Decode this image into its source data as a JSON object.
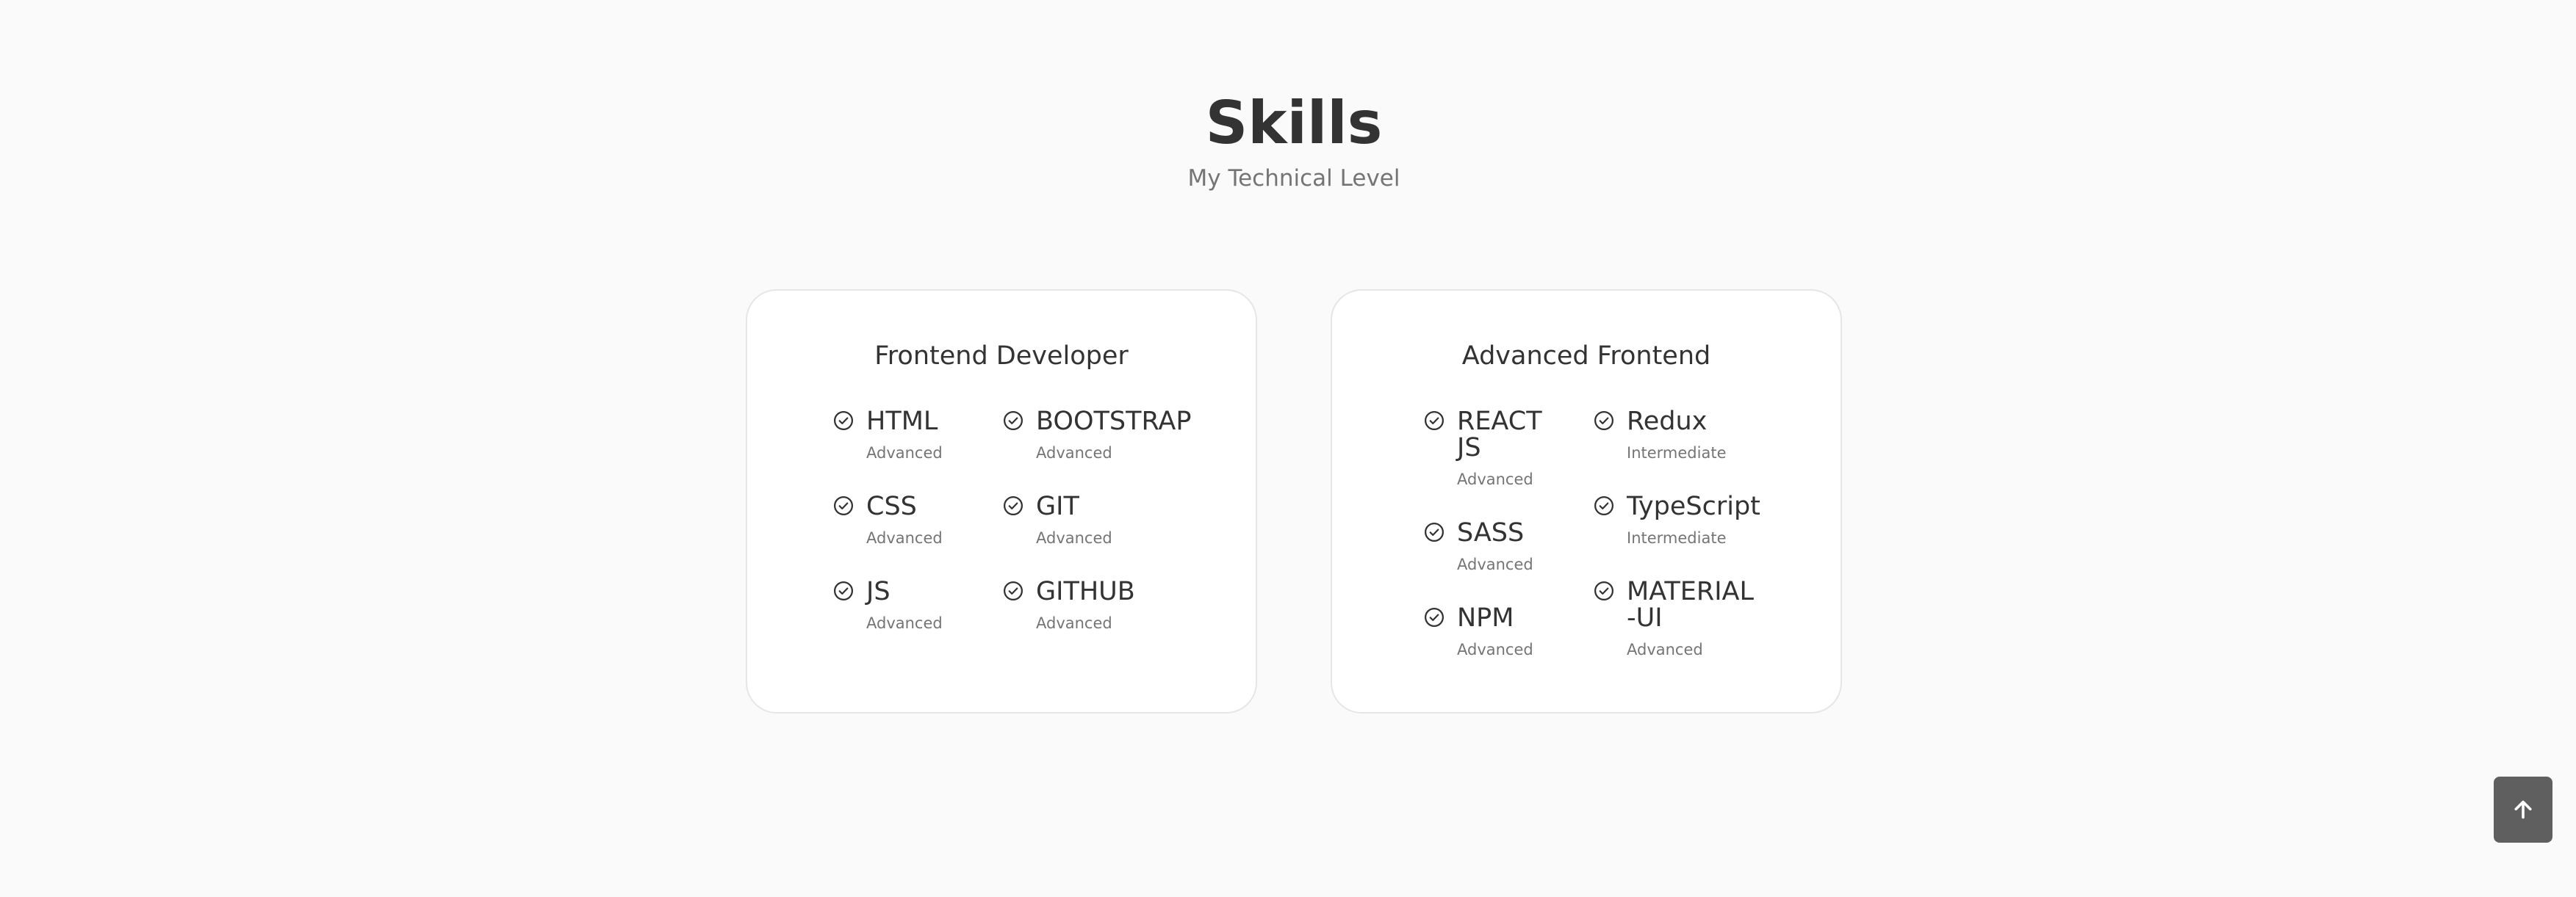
{
  "section": {
    "title": "Skills",
    "subtitle": "My Technical Level"
  },
  "cards": [
    {
      "title": "Frontend Developer",
      "skills": [
        {
          "name": "HTML",
          "level": "Advanced"
        },
        {
          "name": "BOOTSTRAP",
          "level": "Advanced"
        },
        {
          "name": "CSS",
          "level": "Advanced"
        },
        {
          "name": "GIT",
          "level": "Advanced"
        },
        {
          "name": "JS",
          "level": "Advanced"
        },
        {
          "name": "GITHUB",
          "level": "Advanced"
        }
      ]
    },
    {
      "title": "Advanced Frontend",
      "skills": [
        {
          "name": "REACT JS",
          "level": "Advanced"
        },
        {
          "name": "Redux",
          "level": "Intermediate"
        },
        {
          "name": "SASS",
          "level": "Advanced"
        },
        {
          "name": "TypeScript",
          "level": "Intermediate"
        },
        {
          "name": "NPM",
          "level": "Advanced"
        },
        {
          "name": "MATERIAL-UI",
          "level": "Advanced"
        }
      ]
    }
  ],
  "icons": {
    "skill_check": "check-circle-icon",
    "scroll_top": "arrow-up-icon"
  },
  "colors": {
    "background": "#fafafa",
    "card_background": "#ffffff",
    "card_border": "#e6e6e6",
    "title_text": "#333333",
    "muted_text": "#757575",
    "scroll_button": "#5f5f5f"
  }
}
